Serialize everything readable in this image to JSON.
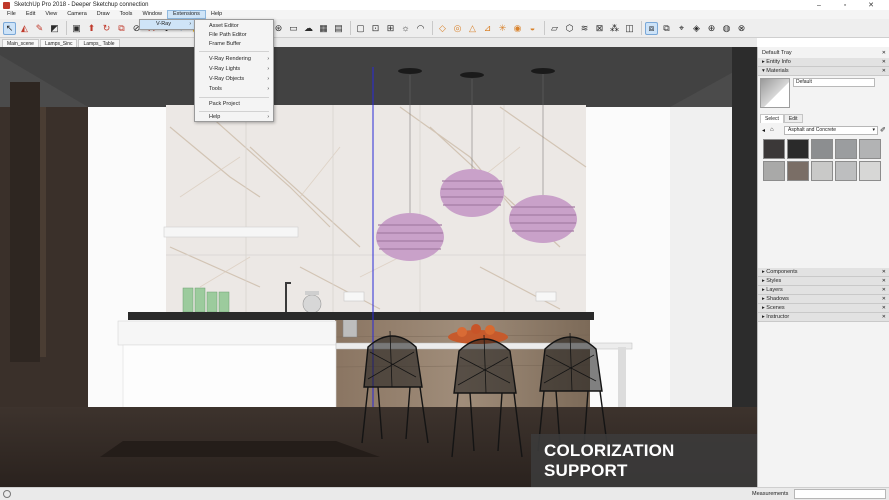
{
  "window": {
    "title": "SketchUp Pro 2018 - Deeper Sketchup connection",
    "minimize": "–",
    "maximize": "▫",
    "close": "✕"
  },
  "menubar": {
    "items": [
      "File",
      "Edit",
      "View",
      "Camera",
      "Draw",
      "Tools",
      "Window",
      "Extensions",
      "Help"
    ],
    "active": "Extensions"
  },
  "toolbar": {
    "icons": [
      "select-icon",
      "eraser-icon",
      "paint-icon",
      "line-icon",
      "box-icon",
      "push-pull-icon",
      "rotate-icon",
      "offset-icon",
      "tape-icon",
      "orbit-icon",
      "pan-icon",
      "zoom-icon",
      "zoom-extents-icon",
      "warehouse-icon",
      "extension-icon",
      "vray-render-icon",
      "vray-interactive-icon",
      "vray-cloud-icon",
      "vray-frame-buffer-icon",
      "vray-options-icon"
    ]
  },
  "scenes": {
    "tabs": [
      "Main_scene",
      "Lamps_Sinc",
      "Lamps_ Table"
    ]
  },
  "ext_menu": {
    "item": "V-Ray",
    "arrow": "›"
  },
  "vray_menu": {
    "items": [
      {
        "label": "Asset Editor",
        "submenu": false
      },
      {
        "label": "File Path Editor",
        "submenu": false
      },
      {
        "label": "Frame Buffer",
        "submenu": false
      },
      {
        "label": "V-Ray Rendering",
        "submenu": true
      },
      {
        "label": "V-Ray Lights",
        "submenu": true
      },
      {
        "label": "V-Ray Objects",
        "submenu": true
      },
      {
        "label": "Tools",
        "submenu": true
      },
      {
        "label": "Pack Project",
        "submenu": false
      },
      {
        "label": "Help",
        "submenu": true
      }
    ],
    "arrow": "›"
  },
  "tray": {
    "title": "Default Tray",
    "entity_info": "Entity Info",
    "materials": "Materials",
    "material_name": "Default",
    "tabs": [
      "Select",
      "Edit"
    ],
    "library": "Asphalt and Concrete",
    "swatch_colors": [
      "#3b3838",
      "#2a2a2a",
      "#8c8e90",
      "#9b9d9f",
      "#b2b3b4",
      "#a9a9a8",
      "#7a6e66",
      "#c9c9c8",
      "#bdbebf",
      "#d7d7d6"
    ],
    "panels": [
      "Components",
      "Styles",
      "Layers",
      "Shadows",
      "Scenes",
      "Instructor"
    ]
  },
  "caption": {
    "text": "COLORIZATION SUPPORT"
  },
  "status": {
    "measurements_label": "Measurements",
    "measurements_value": ""
  },
  "colors": {
    "lamp_pink": "#c9a1c9",
    "caption_bg": "#3c3c3c",
    "wall_white": "#fbfbfb",
    "wood": "#8e7a66",
    "marble": "#e8e3df"
  }
}
